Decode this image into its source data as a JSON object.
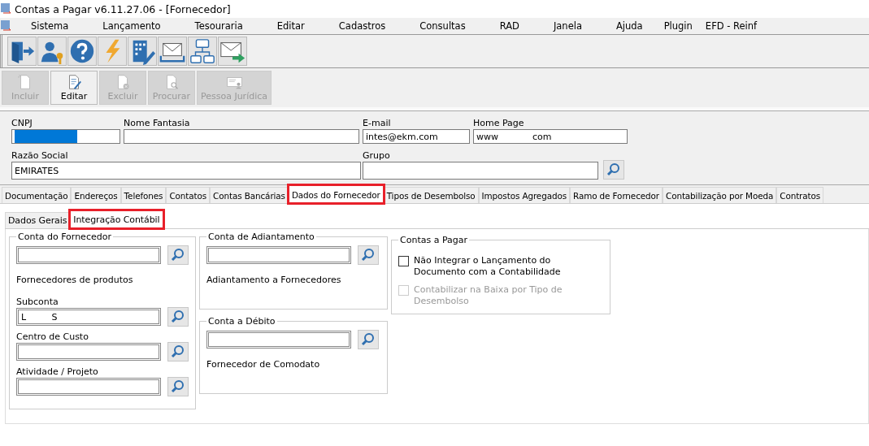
{
  "window": {
    "title": "Contas a Pagar v6.11.27.06 - [Fornecedor]"
  },
  "menu": [
    "Sistema",
    "Lançamento",
    "Tesouraria",
    "Editar",
    "Cadastros",
    "Consultas",
    "RAD",
    "Janela",
    "Ajuda",
    "Plugin",
    "EFD - Reinf"
  ],
  "toolbar": [
    {
      "kind": "exit"
    },
    {
      "kind": "user"
    },
    {
      "kind": "help"
    },
    {
      "kind": "bolt"
    },
    {
      "kind": "building"
    },
    {
      "kind": "inbox"
    },
    {
      "kind": "network"
    },
    {
      "kind": "send"
    }
  ],
  "actions": [
    {
      "label": "Incluir",
      "kind": "new",
      "disabled": true
    },
    {
      "label": "Editar",
      "kind": "edit",
      "disabled": false
    },
    {
      "label": "Excluir",
      "kind": "delete",
      "disabled": true
    },
    {
      "label": "Procurar",
      "kind": "find",
      "disabled": true
    },
    {
      "label": "Pessoa Jurídica",
      "kind": "card",
      "disabled": true
    }
  ],
  "header": {
    "cnpj": {
      "label": "CNPJ"
    },
    "nome_fantasia": {
      "label": "Nome Fantasia"
    },
    "email": {
      "label": "E-mail",
      "value": "intes@ekm.com"
    },
    "home_page": {
      "label": "Home Page",
      "value": "www            com"
    },
    "razao_social": {
      "label": "Razão Social",
      "value": "EMIRATES"
    },
    "grupo": {
      "label": "Grupo"
    }
  },
  "tabs": [
    {
      "label": "Documentação",
      "selected": false,
      "highlighted": false
    },
    {
      "label": "Endereços",
      "selected": false,
      "highlighted": false
    },
    {
      "label": "Telefones",
      "selected": false,
      "highlighted": false
    },
    {
      "label": "Contatos",
      "selected": false,
      "highlighted": false
    },
    {
      "label": "Contas Bancárias",
      "selected": false,
      "highlighted": false
    },
    {
      "label": "Dados do Fornecedor",
      "selected": true,
      "highlighted": true
    },
    {
      "label": "Tipos de Desembolso",
      "selected": false,
      "highlighted": false
    },
    {
      "label": "Impostos Agregados",
      "selected": false,
      "highlighted": false
    },
    {
      "label": "Ramo de Fornecedor",
      "selected": false,
      "highlighted": false
    },
    {
      "label": "Contabilização por Moeda",
      "selected": false,
      "highlighted": false
    },
    {
      "label": "Contratos",
      "selected": false,
      "highlighted": false
    }
  ],
  "subtabs": [
    {
      "label": "Dados Gerais",
      "selected": false,
      "highlighted": false
    },
    {
      "label": "Integração Contábil",
      "selected": true,
      "highlighted": true
    }
  ],
  "conta_fornecedor": {
    "title": "Conta do Fornecedor",
    "description": "Fornecedores de produtos",
    "subconta": {
      "label": "Subconta",
      "value": "L         S"
    },
    "centro_custo": {
      "label": "Centro de Custo"
    },
    "atividade": {
      "label": "Atividade / Projeto"
    }
  },
  "conta_adiantamento": {
    "title": "Conta de Adiantamento",
    "description": "Adiantamento a Fornecedores"
  },
  "conta_debito": {
    "title": "Conta a Débito",
    "description": "Fornecedor de Comodato"
  },
  "contas_pagar": {
    "title": "Contas a Pagar",
    "options": [
      {
        "label": "Não Integrar o Lançamento do Documento com a Contabilidade",
        "checked": false,
        "disabled": false
      },
      {
        "label": "Contabilizar na Baixa por Tipo de Desembolso",
        "checked": false,
        "disabled": true
      }
    ]
  }
}
